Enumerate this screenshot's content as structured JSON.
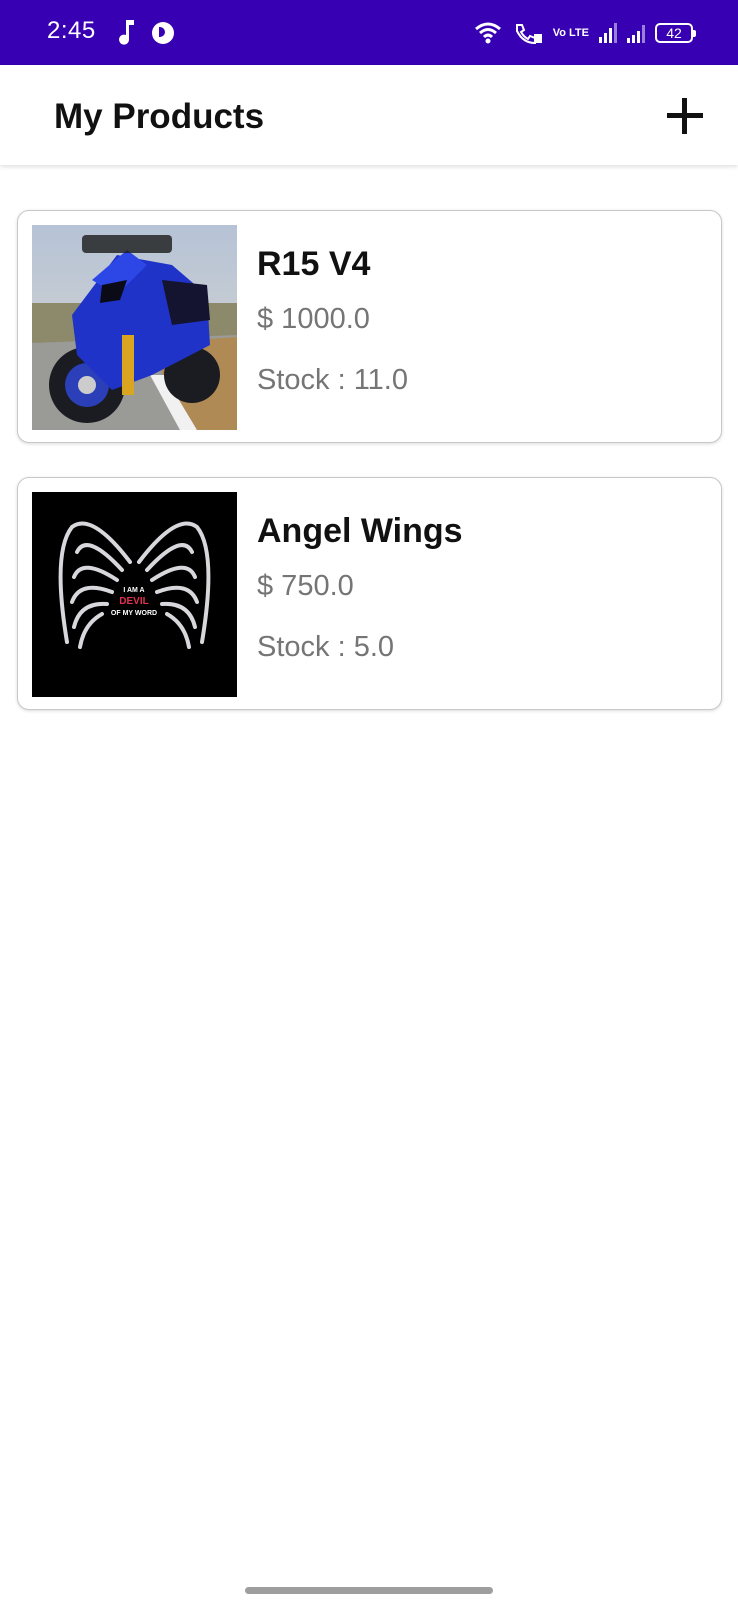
{
  "status_bar": {
    "time": "2:45",
    "battery": "42",
    "volte": "Vo LTE",
    "background": "#3700b3"
  },
  "app_bar": {
    "title": "My Products",
    "add_icon": "plus-icon"
  },
  "products": [
    {
      "name": "R15 V4",
      "price": "$ 1000.0",
      "stock": "Stock : 11.0",
      "image": "blue-motorcycle-photo"
    },
    {
      "name": "Angel Wings",
      "price": "$ 750.0",
      "stock": "Stock : 5.0",
      "image": "angel-wings-graphic",
      "image_text": [
        "I AM A",
        "DEVIL",
        "OF MY WORD"
      ]
    }
  ]
}
